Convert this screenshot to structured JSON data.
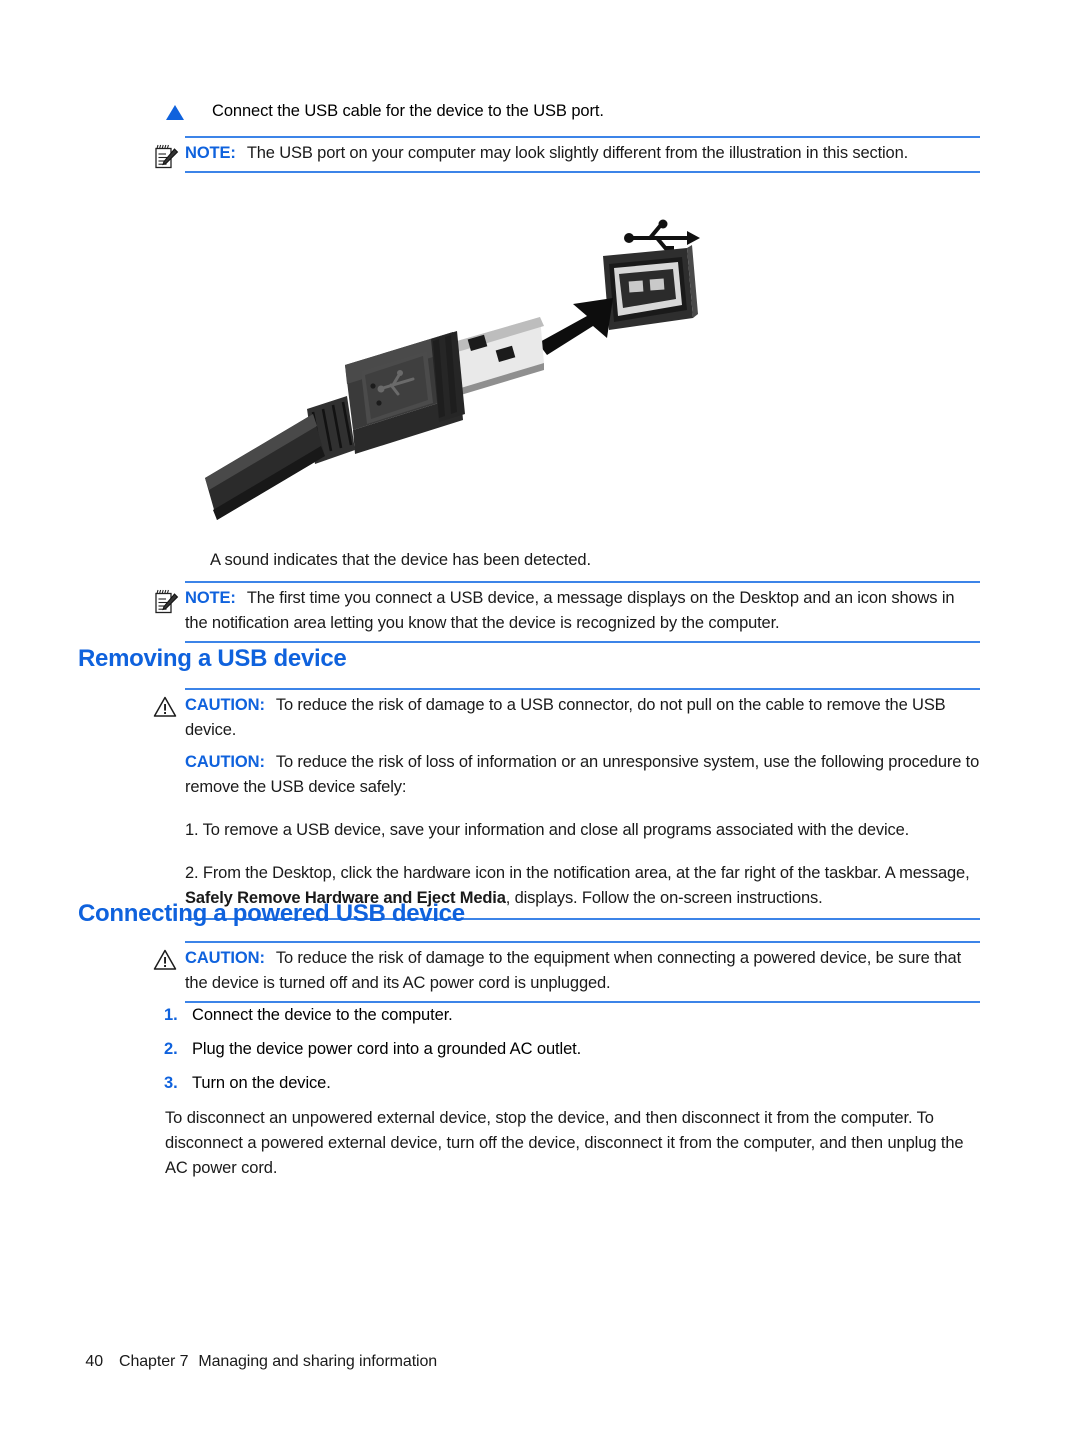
{
  "document": {
    "page_number": "40",
    "chapter_label": "Chapter 7",
    "chapter_title": "Managing and sharing information"
  },
  "colors": {
    "accent_blue": "#0f62dd",
    "rule_blue": "#3c84e8",
    "body_text": "#1a1a1a"
  },
  "blocks": {
    "step_connect_cable": "Connect the USB cable for the device to the USB port.",
    "note_usb_port": {
      "label": "NOTE:",
      "text": "The USB port on your computer may look slightly different from the illustration in this section."
    },
    "illustration": {
      "alt": "USB Type-A plug being inserted into a USB port, with a USB trident symbol above the port",
      "icons": [
        "usb-plug",
        "usb-port",
        "usb-trident-symbol",
        "insertion-arrow"
      ]
    },
    "sound_detected": "A sound indicates that the device has been detected.",
    "note_first_time": {
      "label": "NOTE:",
      "text": "The first time you connect a USB device, a message displays on the Desktop and an icon shows in the notification area letting you know that the device is recognized by the computer."
    },
    "heading_removing": "Removing a USB device",
    "caution_connector": {
      "label": "CAUTION:",
      "text": "To reduce the risk of damage to a USB connector, do not pull on the cable to remove the USB device."
    },
    "caution_procedure": {
      "label": "CAUTION:",
      "text": "To reduce the risk of loss of information or an unresponsive system, use the following procedure to remove the USB device safely:",
      "steps": [
        {
          "number": "1.",
          "text": "To remove a USB device, save your information and close all programs associated with the device."
        },
        {
          "number": "2.",
          "text_before": "From the Desktop, click the hardware icon in the notification area, at the far right of the taskbar. A message, ",
          "bold": "Safely Remove Hardware and Eject Media",
          "text_after": ", displays. Follow the on-screen instructions."
        }
      ]
    },
    "heading_connecting": "Connecting a powered USB device",
    "caution_powered": {
      "label": "CAUTION:",
      "text": "To reduce the risk of damage to the equipment when connecting a powered device, be sure that the device is turned off and its AC power cord is unplugged."
    },
    "powered_steps": [
      {
        "number": "1.",
        "text": "Connect the device to the computer."
      },
      {
        "number": "2.",
        "text": "Plug the device power cord into a grounded AC outlet."
      },
      {
        "number": "3.",
        "text": "Turn on the device."
      }
    ],
    "disconnect_paragraph": "To disconnect an unpowered external device, stop the device, and then disconnect it from the computer. To disconnect a powered external device, turn off the device, disconnect it from the computer, and then unplug the AC power cord."
  }
}
